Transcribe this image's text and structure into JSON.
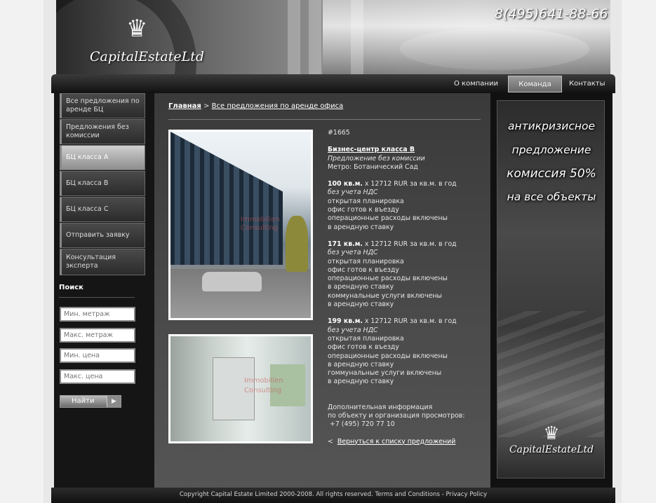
{
  "header": {
    "logo_text": "CapitalEstateLtd",
    "phone": "8(495)641-88-66"
  },
  "nav": {
    "items": [
      {
        "label": "О компании",
        "active": false
      },
      {
        "label": "Команда",
        "active": true
      },
      {
        "label": "Контакты",
        "active": false
      }
    ]
  },
  "sidebar": {
    "items": [
      {
        "label": "Все предложения по аренде БЦ"
      },
      {
        "label": "Предложения без комиссии"
      },
      {
        "label": "БЦ класса А",
        "active": true
      },
      {
        "label": "БЦ класса В"
      },
      {
        "label": "БЦ класса С"
      },
      {
        "label": "Отправить заявку"
      },
      {
        "label": "Консультация эксперта"
      }
    ]
  },
  "search": {
    "title": "Поиск",
    "min_area_placeholder": "Мин. метраж",
    "max_area_placeholder": "Макс. метраж",
    "min_price_placeholder": "Мин. цена",
    "max_price_placeholder": "Макс. цена",
    "button_label": "Найти"
  },
  "breadcrumb": {
    "home": "Главная",
    "separator": ">",
    "current": "Все предложения по аренде офиса"
  },
  "photos": {
    "watermark_1": "Immobilien",
    "watermark_2": "Consulting"
  },
  "listing": {
    "id": "#1665",
    "title": "Бизнес-центр класса B",
    "subtitle": "Предложение без комиссии",
    "metro": "Метро: Ботанический Сад",
    "offers": [
      {
        "area": "100 кв.м.",
        "price": " x 12712 RUR за кв.м. в год",
        "vat": "без учета НДС",
        "features": [
          "открытая планировка",
          "офис готов к въезду",
          "операционные расходы включены",
          "в арендную ставку"
        ]
      },
      {
        "area": "171 кв.м.",
        "price": " x 12712 RUR за кв.м. в год",
        "vat": "без учета НДС",
        "features": [
          "открытая планировка",
          "офис готов к въезду",
          "операционные расходы включены",
          "в арендную ставку",
          "коммунальные услуги включены",
          "в арендную ставку"
        ]
      },
      {
        "area": "199 кв.м.",
        "price": " x 12712 RUR за кв.м. в год",
        "vat": "без учета НДС",
        "features": [
          "открытая планировка",
          "офис готов к въезду",
          "операционные расходы включены",
          "в арендную ставку",
          "гоммунальные услуги включены",
          "в арендную ставку"
        ]
      }
    ],
    "extra_info_1": "Дополнительная информация",
    "extra_info_2": "по объекту и организация просмотров:",
    "extra_phone": " +7 (495) 720 77 10",
    "back_prefix": "<",
    "back_link": "Вернуться к списку предложений"
  },
  "promo": {
    "lines": [
      "антикризисное",
      "предложение",
      "комиссия 50%",
      "на все объекты"
    ],
    "logo_text": "CapitalEstateLtd"
  },
  "footer": {
    "text": "Copyright Capital Estate Limited 2000-2008. All rights reserved. Terms and Conditions - Privacy Policy"
  }
}
